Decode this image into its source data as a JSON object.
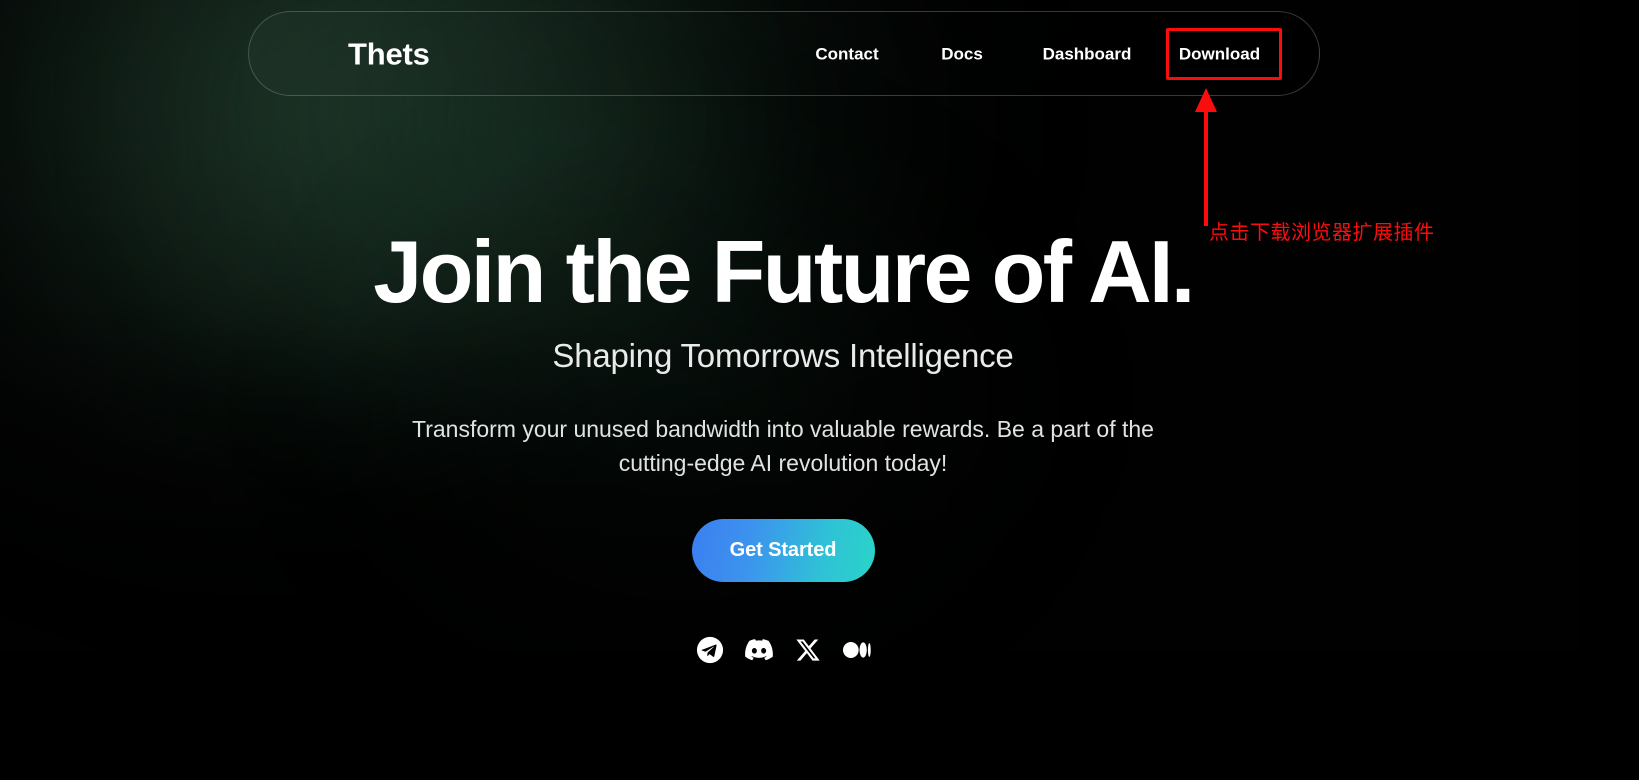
{
  "site": {
    "brand": "Thets"
  },
  "nav": {
    "items": [
      {
        "label": "Contact",
        "name": "nav-link-contact"
      },
      {
        "label": "Docs",
        "name": "nav-link-docs"
      },
      {
        "label": "Dashboard",
        "name": "nav-link-dashboard"
      },
      {
        "label": "Download",
        "name": "nav-link-download"
      }
    ]
  },
  "hero": {
    "headline": "Join the Future of AI.",
    "subhead": "Shaping Tomorrows Intelligence",
    "body": "Transform your unused bandwidth into valuable rewards. Be a part of the cutting-edge AI revolution today!",
    "cta_label": "Get Started"
  },
  "socials": [
    {
      "name": "telegram-icon",
      "label": "Telegram"
    },
    {
      "name": "discord-icon",
      "label": "Discord"
    },
    {
      "name": "x-twitter-icon",
      "label": "X"
    },
    {
      "name": "medium-icon",
      "label": "Medium"
    }
  ],
  "annotation": {
    "caption": "点击下载浏览器扩展插件",
    "target": "Download",
    "color": "#fb0d0d"
  },
  "colors": {
    "background": "#010101",
    "glow_green": "#3a684e",
    "text_primary": "#ffffff",
    "text_secondary": "#dfe3e1",
    "cta_gradient_start": "#3b7ff0",
    "cta_gradient_end": "#2ad4c8",
    "annotation_red": "#fb0d0d",
    "navbar_border": "rgba(152,170,160,0.34)"
  }
}
